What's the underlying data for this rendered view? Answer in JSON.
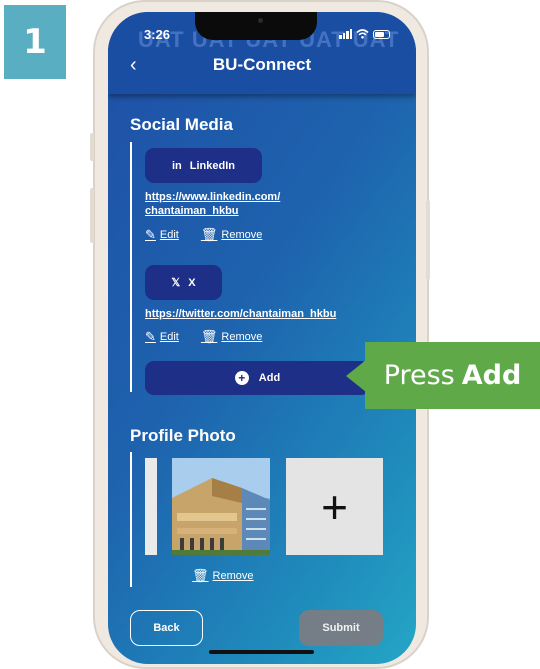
{
  "step_number": "1",
  "status_bar": {
    "time": "3:26",
    "watermark": "UAT UAT UAT UAT UAT"
  },
  "header": {
    "title": "BU-Connect"
  },
  "social_media": {
    "title": "Social Media",
    "items": [
      {
        "platform": "LinkedIn",
        "icon_glyph": "in",
        "url_line1": "https://www.linkedin.com/",
        "url_line2": "chantaiman_hkbu",
        "edit_label": "Edit",
        "remove_label": "Remove"
      },
      {
        "platform": "X",
        "icon_glyph": "𝕏",
        "url_line1": "https://twitter.com/chantaiman_hkbu",
        "url_line2": "",
        "edit_label": "Edit",
        "remove_label": "Remove"
      }
    ],
    "add_label": "Add"
  },
  "profile_photo": {
    "title": "Profile Photo",
    "remove_label": "Remove",
    "add_tile_glyph": "+"
  },
  "footer": {
    "back_label": "Back",
    "submit_label": "Submit"
  },
  "callout": {
    "prefix": "Press",
    "action": "Add"
  },
  "colors": {
    "accent_navy": "#1d2f86",
    "header": "#1a4ea3",
    "callout_green": "#60a949",
    "step_badge": "#5aaec2",
    "submit_disabled": "#757d86"
  }
}
